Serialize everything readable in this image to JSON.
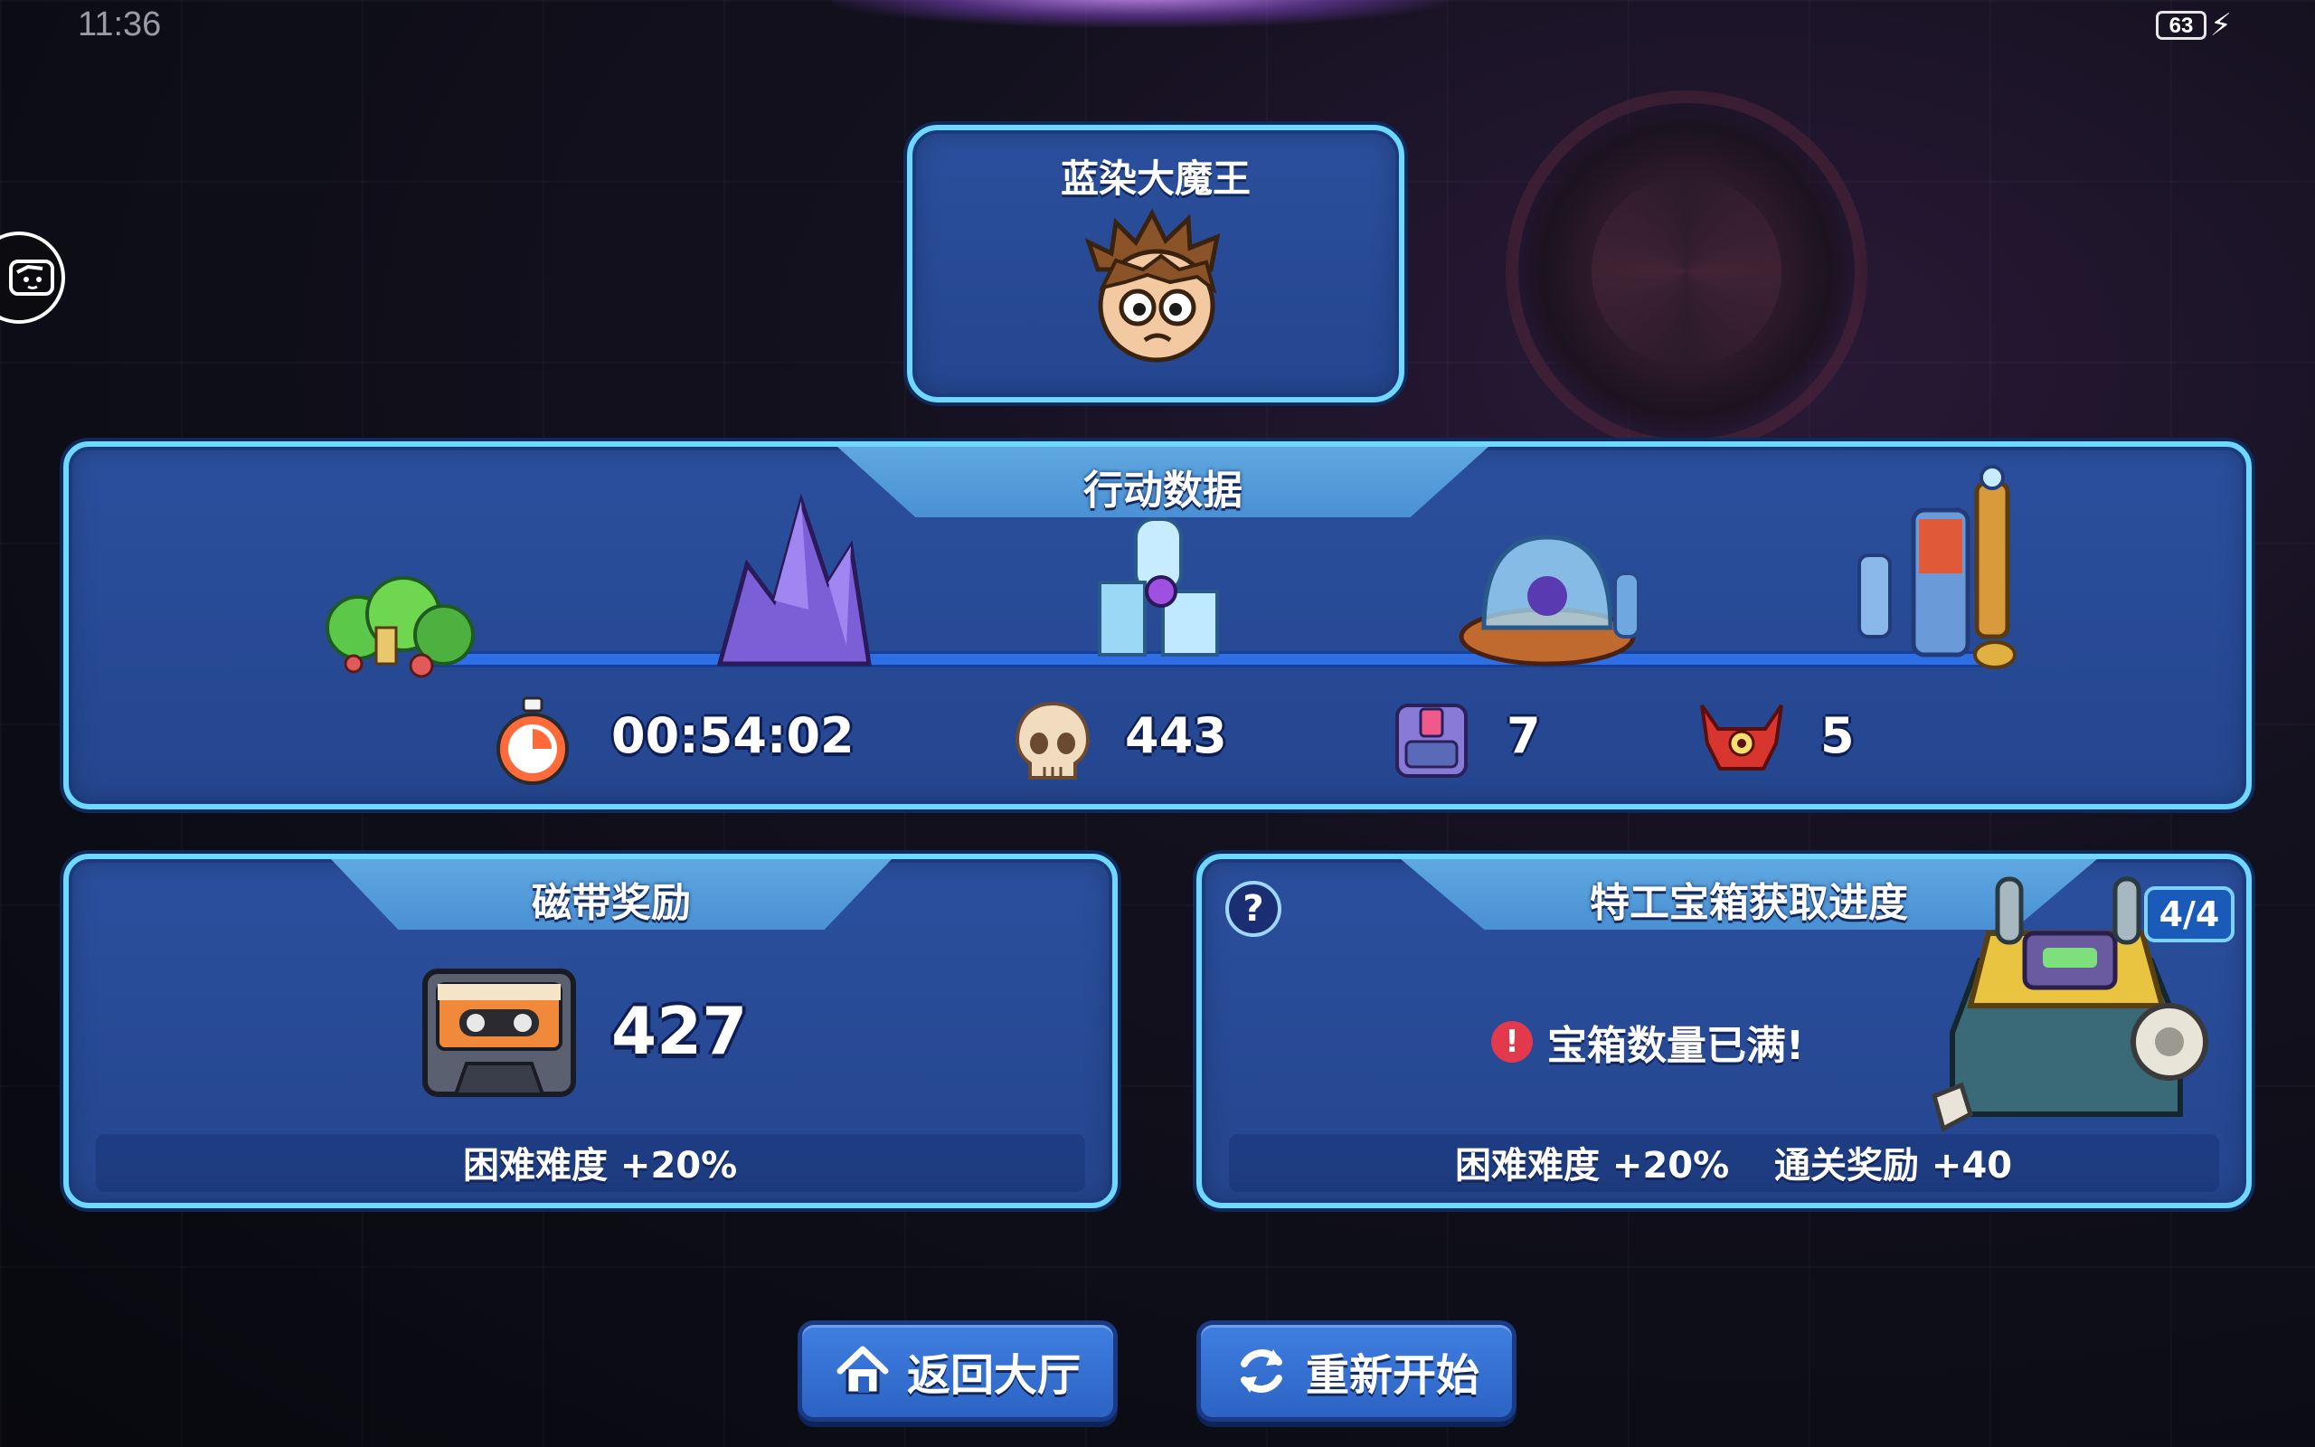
{
  "status_bar": {
    "time": "11:36",
    "battery_level": "63"
  },
  "boss": {
    "name": "蓝染大魔王"
  },
  "action_data": {
    "title": "行动数据",
    "time": "00:54:02",
    "kills": "443",
    "chests": "7",
    "bosses": "5"
  },
  "tape_reward": {
    "title": "磁带奖励",
    "amount": "427",
    "difficulty_bonus": "困难难度 +20%"
  },
  "agent_chest": {
    "title": "特工宝箱获取进度",
    "progress": "4/4",
    "full_message": "宝箱数量已满!",
    "difficulty_bonus": "困难难度 +20%",
    "clear_bonus": "通关奖励 +40"
  },
  "buttons": {
    "back_lobby": "返回大厅",
    "restart": "重新开始"
  },
  "colors": {
    "panel_fill": "#2b4f9d",
    "panel_border": "#6fd8ff",
    "tab_fill": "#4a90d4",
    "button_fill": "#3f7fe0",
    "warning": "#e23a4c"
  }
}
